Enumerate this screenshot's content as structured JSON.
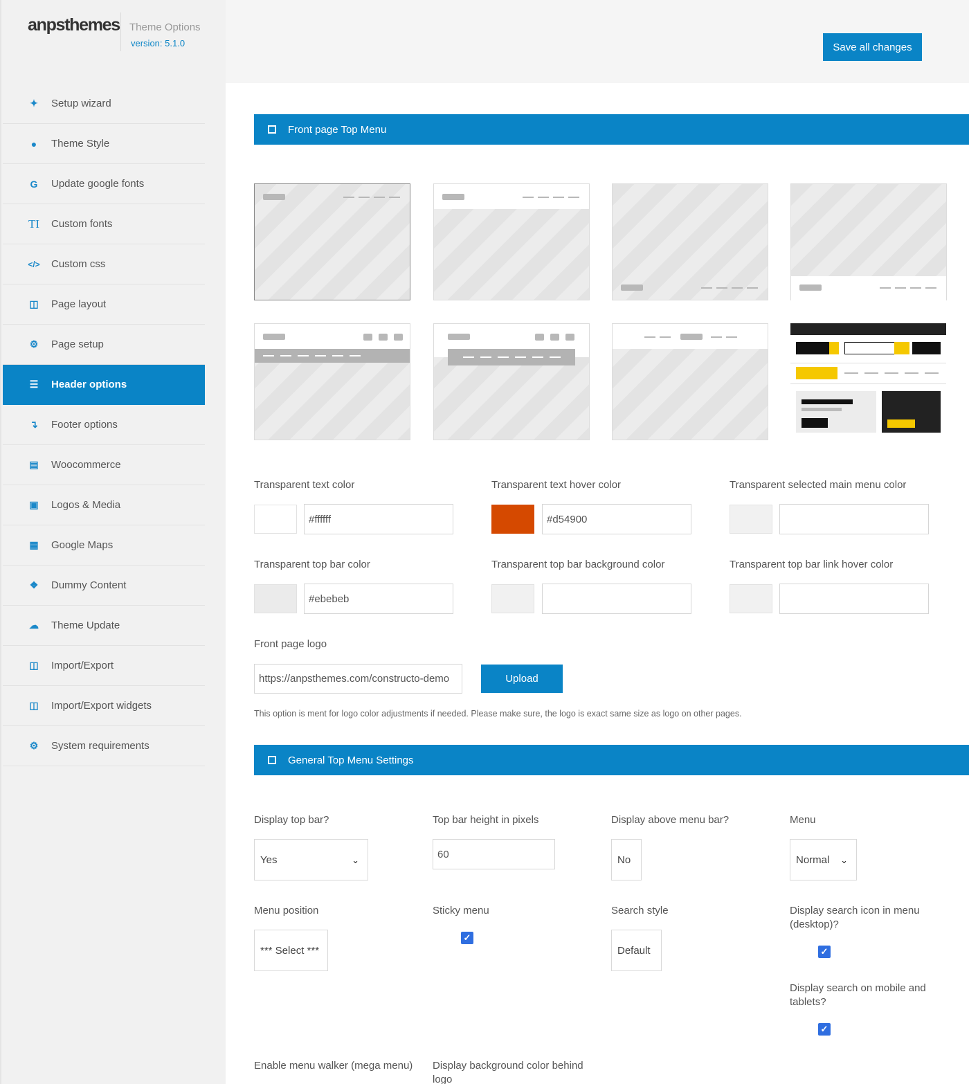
{
  "brand": {
    "name": "anpsthemes",
    "subtitle": "Theme Options",
    "version": "version: 5.1.0"
  },
  "toolbar": {
    "save_label": "Save all changes"
  },
  "sidebar": {
    "items": [
      {
        "label": "Setup wizard",
        "icon": "magic-wand-icon"
      },
      {
        "label": "Theme Style",
        "icon": "droplet-icon"
      },
      {
        "label": "Update google fonts",
        "icon": "google-icon"
      },
      {
        "label": "Custom fonts",
        "icon": "typography-icon"
      },
      {
        "label": "Custom css",
        "icon": "code-icon"
      },
      {
        "label": "Page layout",
        "icon": "columns-icon"
      },
      {
        "label": "Page setup",
        "icon": "gear-icon"
      },
      {
        "label": "Header options",
        "icon": "menu-bars-icon",
        "active": true
      },
      {
        "label": "Footer options",
        "icon": "arrow-down-icon"
      },
      {
        "label": "Woocommerce",
        "icon": "basket-icon"
      },
      {
        "label": "Logos & Media",
        "icon": "image-icon"
      },
      {
        "label": "Google Maps",
        "icon": "map-icon"
      },
      {
        "label": "Dummy Content",
        "icon": "dropbox-icon"
      },
      {
        "label": "Theme Update",
        "icon": "cloud-download-icon"
      },
      {
        "label": "Import/Export",
        "icon": "file-code-icon"
      },
      {
        "label": "Import/Export widgets",
        "icon": "file-code-icon"
      },
      {
        "label": "System requirements",
        "icon": "gears-icon"
      }
    ]
  },
  "section1": {
    "title": "Front page Top Menu",
    "colors": {
      "transparent_text": {
        "label": "Transparent text color",
        "value": "#ffffff",
        "swatch": "#ffffff"
      },
      "transparent_text_hover": {
        "label": "Transparent text hover color",
        "value": "#d54900",
        "swatch": "#d54900"
      },
      "transparent_selected": {
        "label": "Transparent selected main menu color",
        "value": "",
        "swatch": "#f1f1f1"
      },
      "top_bar": {
        "label": "Transparent top bar color",
        "value": "#ebebeb",
        "swatch": "#ebebeb"
      },
      "top_bar_bg": {
        "label": "Transparent top bar background color",
        "value": "",
        "swatch": "#f1f1f1"
      },
      "top_bar_link_hover": {
        "label": "Transparent top bar link hover color",
        "value": "",
        "swatch": "#f1f1f1"
      }
    },
    "logo": {
      "label": "Front page logo",
      "value": "https://anpsthemes.com/constructo-demo",
      "upload_label": "Upload",
      "note": "This option is ment for logo color adjustments if needed. Please make sure, the logo is exact same size as logo on other pages."
    }
  },
  "section2": {
    "title": "General Top Menu Settings",
    "display_top_bar": {
      "label": "Display top bar?",
      "value": "Yes"
    },
    "top_bar_height": {
      "label": "Top bar height in pixels",
      "value": "60"
    },
    "display_above_menu": {
      "label": "Display above menu bar?",
      "value": "No"
    },
    "menu": {
      "label": "Menu",
      "value": "Normal"
    },
    "menu_position": {
      "label": "Menu position",
      "value": "*** Select ***"
    },
    "sticky_menu": {
      "label": "Sticky menu",
      "checked": true
    },
    "search_style": {
      "label": "Search style",
      "value": "Default"
    },
    "search_icon_desktop": {
      "label": "Display search icon in menu (desktop)?",
      "checked": true
    },
    "search_mobile": {
      "label": "Display search on mobile and tablets?",
      "checked": true
    },
    "mega_menu": {
      "label": "Enable menu walker (mega menu)"
    },
    "bg_behind_logo": {
      "label": "Display background color behind logo"
    }
  },
  "accent": "#0a84c6"
}
